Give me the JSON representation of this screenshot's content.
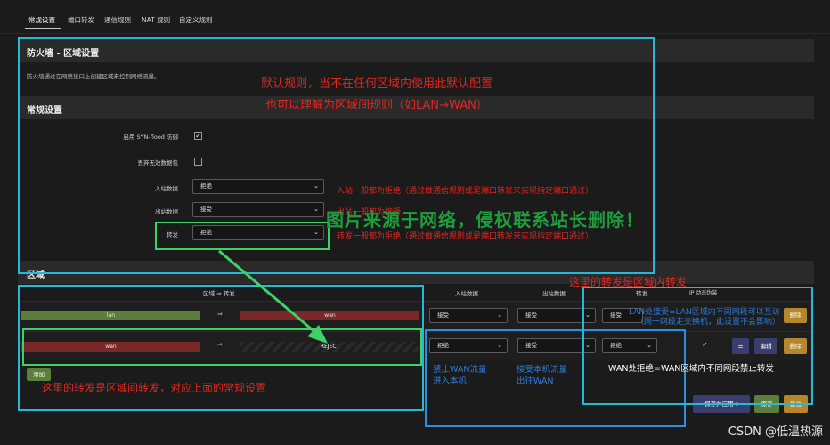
{
  "tabs": [
    {
      "label": "常规设置",
      "active": true
    },
    {
      "label": "端口转发"
    },
    {
      "label": "通信规则"
    },
    {
      "label": "NAT 规则"
    },
    {
      "label": "自定义规则"
    }
  ],
  "page": {
    "title": "防火墙 - 区域设置",
    "description": "防火墙通过在网络接口上创建区域来控制网络流量。"
  },
  "general": {
    "title": "常规设置",
    "syn_flood_label": "启用 SYN-flood 防御",
    "syn_flood_checked": "✓",
    "drop_invalid_label": "丢弃无效数据包",
    "input_label": "入站数据",
    "input_value": "拒绝",
    "output_label": "出站数据",
    "output_value": "接受",
    "forward_label": "转发",
    "forward_value": "拒绝"
  },
  "zones": {
    "title": "区域",
    "col_zone_forward": "区域 ⇒ 转发",
    "col_input": "入站数据",
    "col_output": "出站数据",
    "col_forward": "转发",
    "col_masq": "IP 动态伪装",
    "arrow": "⇒",
    "rows": [
      {
        "zone": "lan",
        "dest": "wan",
        "input": "接受",
        "output": "接受",
        "forward": "接受",
        "masq": ""
      },
      {
        "zone": "wan",
        "dest": "REJECT",
        "input": "拒绝",
        "output": "接受",
        "forward": "拒绝",
        "masq": "✓"
      }
    ],
    "add_label": "添加",
    "menu_label": "☰",
    "edit_label": "编辑",
    "delete_label": "删除"
  },
  "footer": {
    "save_apply_label": "保存并应用",
    "save_label": "保存",
    "reset_label": "复位"
  },
  "annotations": {
    "default_rule_1": "默认规则，当不在任何区域内使用此默认配置",
    "default_rule_2": "也可以理解为区域间规则（如LAN→WAN）",
    "input_note": "入站一般都为拒绝（通过做通信规则或是端口转发来实现指定端口通过）",
    "output_note": "出站一般都为接受",
    "forward_note": "转发一般都为拒绝（通过做通信规则或是端口转发来实现指定端口通过）",
    "inner_forward": "这里的转发是区域内转发",
    "lan_accept_1": "LAN处接受=LAN区域内不同网段可以互访",
    "lan_accept_2": "（同一网段走交换机，此设置不会影响）",
    "wan_reject": "WAN处拒绝=WAN区域内不同网段禁止转发",
    "block_wan_in_1": "禁止WAN流量",
    "block_wan_in_2": "进入本机",
    "accept_out_1": "接受本机流量",
    "accept_out_2": "出往WAN",
    "inter_forward": "这里的转发是区域间转发，对应上面的常规设置",
    "center_watermark": "图片来源于网络，侵权联系站长删除！",
    "csdn": "CSDN @低温热源"
  }
}
